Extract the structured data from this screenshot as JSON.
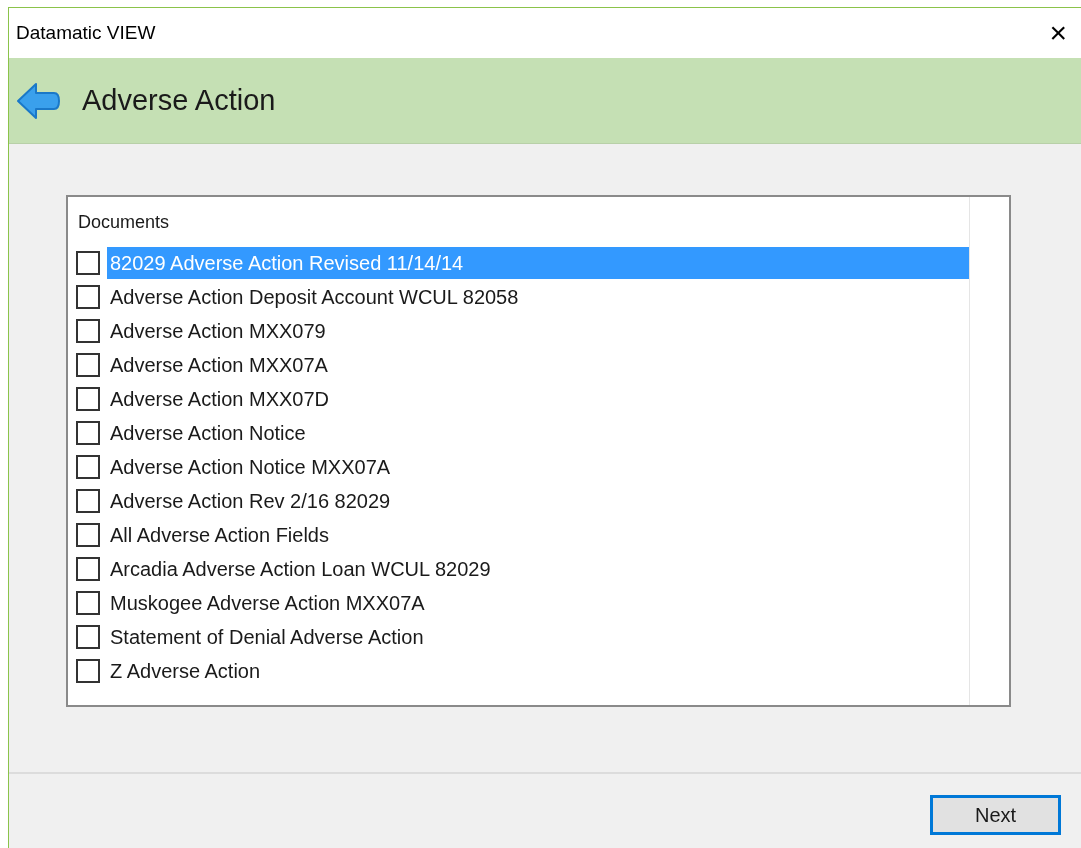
{
  "window": {
    "title": "Datamatic VIEW",
    "close": "×"
  },
  "header": {
    "title": "Adverse Action"
  },
  "documents": {
    "column": "Documents",
    "items": [
      {
        "label": "82029 Adverse Action Revised 11/14/14",
        "checked": false,
        "selected": true
      },
      {
        "label": "Adverse Action Deposit Account WCUL 82058",
        "checked": false,
        "selected": false
      },
      {
        "label": "Adverse Action MXX079",
        "checked": false,
        "selected": false
      },
      {
        "label": "Adverse Action MXX07A",
        "checked": false,
        "selected": false
      },
      {
        "label": "Adverse Action MXX07D",
        "checked": false,
        "selected": false
      },
      {
        "label": "Adverse Action Notice",
        "checked": false,
        "selected": false
      },
      {
        "label": "Adverse Action Notice MXX07A",
        "checked": false,
        "selected": false
      },
      {
        "label": "Adverse Action Rev 2/16 82029",
        "checked": false,
        "selected": false
      },
      {
        "label": "All Adverse Action Fields",
        "checked": false,
        "selected": false
      },
      {
        "label": "Arcadia Adverse Action Loan WCUL 82029",
        "checked": false,
        "selected": false
      },
      {
        "label": "Muskogee Adverse Action MXX07A",
        "checked": false,
        "selected": false
      },
      {
        "label": "Statement of Denial Adverse Action",
        "checked": false,
        "selected": false
      },
      {
        "label": "Z Adverse Action",
        "checked": false,
        "selected": false
      }
    ]
  },
  "buttons": [
    "Next"
  ]
}
